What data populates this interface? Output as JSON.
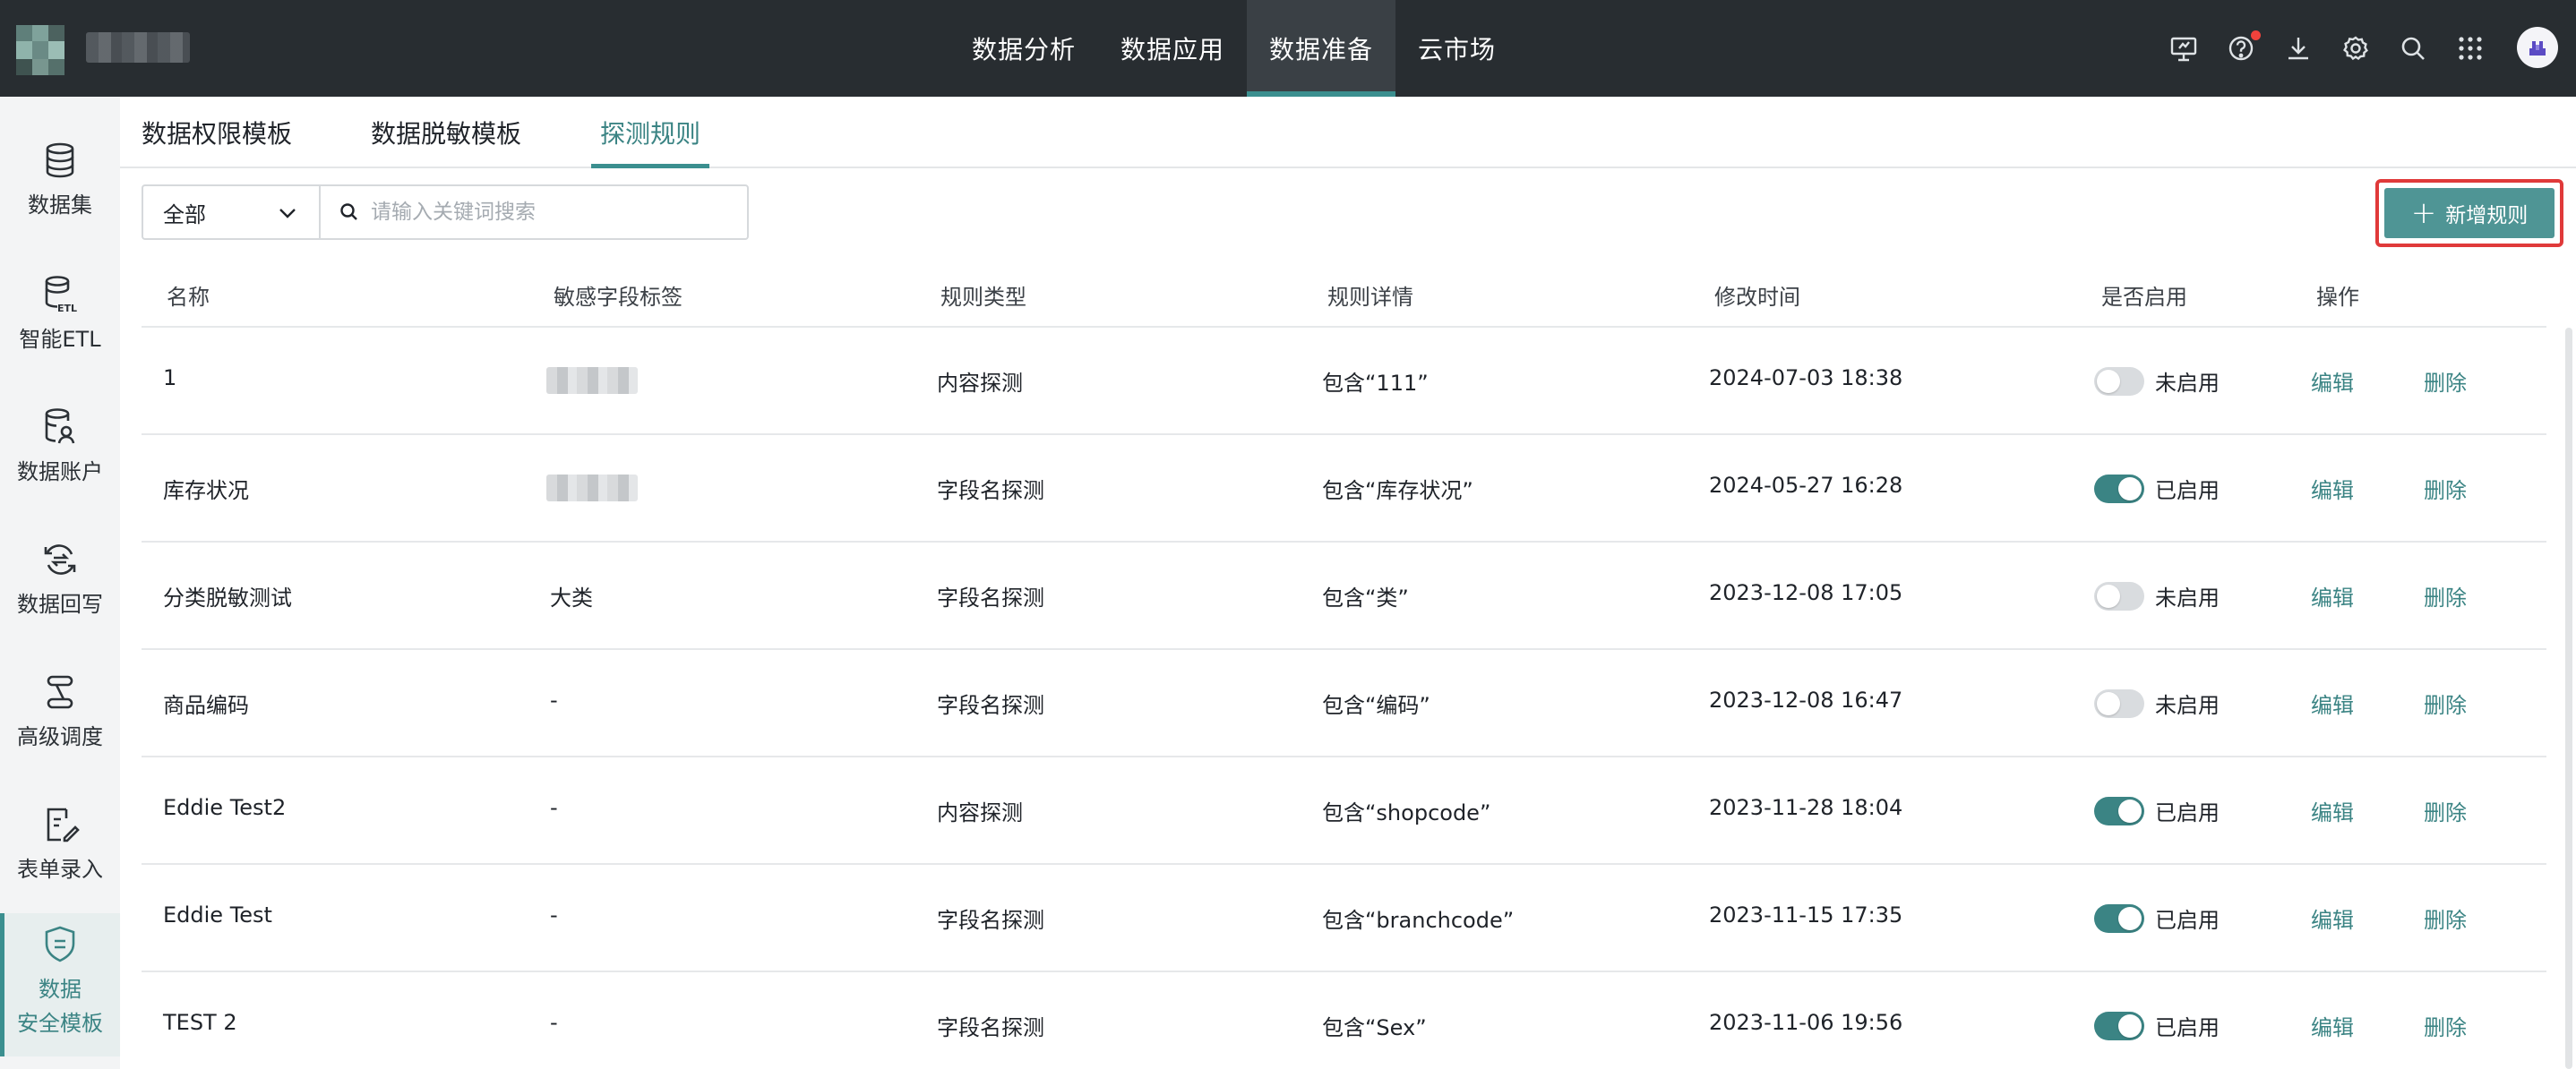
{
  "topbar": {
    "nav": [
      {
        "label": "数据分析",
        "active": false
      },
      {
        "label": "数据应用",
        "active": false
      },
      {
        "label": "数据准备",
        "active": true
      },
      {
        "label": "云市场",
        "active": false
      }
    ],
    "icons": [
      "monitor-icon",
      "help-icon",
      "download-icon",
      "gear-icon",
      "search-icon",
      "apps-grid-icon"
    ],
    "notification_dot_color": "#f0423c"
  },
  "sidebar": {
    "items": [
      {
        "label": "数据集",
        "icon": "database-icon"
      },
      {
        "label": "智能ETL",
        "icon": "etl-icon"
      },
      {
        "label": "数据账户",
        "icon": "data-account-icon"
      },
      {
        "label": "数据回写",
        "icon": "writeback-icon"
      },
      {
        "label": "高级调度",
        "icon": "schedule-icon"
      },
      {
        "label": "表单录入",
        "icon": "form-entry-icon"
      },
      {
        "label_line1": "数据",
        "label_line2": "安全模板",
        "icon": "security-template-icon",
        "active": true
      }
    ]
  },
  "tabs": [
    {
      "label": "数据权限模板",
      "active": false
    },
    {
      "label": "数据脱敏模板",
      "active": false
    },
    {
      "label": "探测规则",
      "active": true
    }
  ],
  "filter": {
    "select_value": "全部",
    "search_placeholder": "请输入关键词搜索"
  },
  "add_button_label": "新增规则",
  "accent_color": "#3b8484",
  "table": {
    "columns": [
      "名称",
      "敏感字段标签",
      "规则类型",
      "规则详情",
      "修改时间",
      "是否启用",
      "操作"
    ],
    "rows": [
      {
        "name": "1",
        "tag": "",
        "tag_blurred": true,
        "type": "内容探测",
        "detail": "包含“111”",
        "modified": "2024-07-03 18:38",
        "enabled": false,
        "status": "未启用",
        "edit": "编辑",
        "delete": "删除"
      },
      {
        "name": "库存状况",
        "tag": "",
        "tag_blurred": true,
        "type": "字段名探测",
        "detail": "包含“库存状况”",
        "modified": "2024-05-27 16:28",
        "enabled": true,
        "status": "已启用",
        "edit": "编辑",
        "delete": "删除"
      },
      {
        "name": "分类脱敏测试",
        "tag": "大类",
        "tag_blurred": false,
        "type": "字段名探测",
        "detail": "包含“类”",
        "modified": "2023-12-08 17:05",
        "enabled": false,
        "status": "未启用",
        "edit": "编辑",
        "delete": "删除"
      },
      {
        "name": "商品编码",
        "tag": "-",
        "tag_blurred": false,
        "type": "字段名探测",
        "detail": "包含“编码”",
        "modified": "2023-12-08 16:47",
        "enabled": false,
        "status": "未启用",
        "edit": "编辑",
        "delete": "删除"
      },
      {
        "name": "Eddie Test2",
        "tag": "-",
        "tag_blurred": false,
        "type": "内容探测",
        "detail": "包含“shopcode”",
        "modified": "2023-11-28 18:04",
        "enabled": true,
        "status": "已启用",
        "edit": "编辑",
        "delete": "删除"
      },
      {
        "name": "Eddie Test",
        "tag": "-",
        "tag_blurred": false,
        "type": "字段名探测",
        "detail": "包含“branchcode”",
        "modified": "2023-11-15 17:35",
        "enabled": true,
        "status": "已启用",
        "edit": "编辑",
        "delete": "删除"
      },
      {
        "name": "TEST 2",
        "tag": "-",
        "tag_blurred": false,
        "type": "字段名探测",
        "detail": "包含“Sex”",
        "modified": "2023-11-06 19:56",
        "enabled": true,
        "status": "已启用",
        "edit": "编辑",
        "delete": "删除"
      }
    ]
  }
}
